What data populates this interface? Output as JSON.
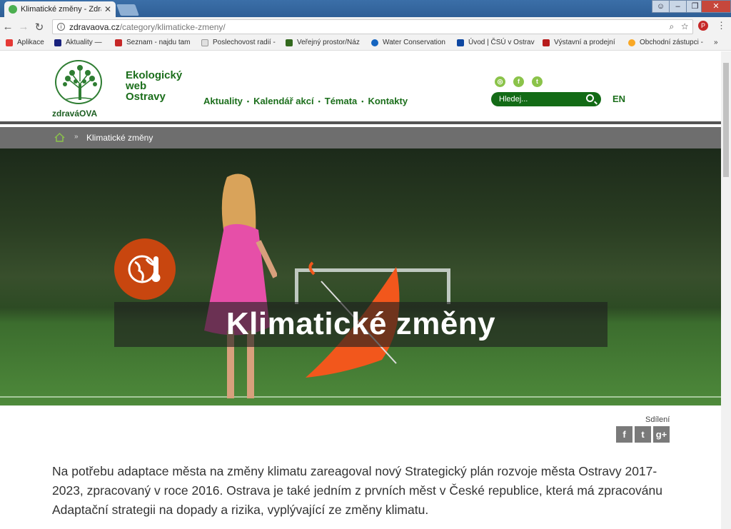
{
  "browser": {
    "tab_title": "Klimatické změny - Zdrav",
    "url_domain": "zdravaova.cz",
    "url_path": "/category/klimaticke-zmeny/",
    "bookmarks": [
      {
        "label": "Aplikace",
        "color": "#e53935"
      },
      {
        "label": "Aktuality —",
        "color": "#1a237e"
      },
      {
        "label": "Seznam - najdu tam",
        "color": "#c62828"
      },
      {
        "label": "Poslechovost radií -",
        "color": "#9e9e9e"
      },
      {
        "label": "Veřejný prostor/Náz",
        "color": "#33691e"
      },
      {
        "label": "Water Conservation",
        "color": "#1565c0"
      },
      {
        "label": "Úvod | ČSÚ v Ostrav",
        "color": "#0d47a1"
      },
      {
        "label": "Výstavní a prodejní",
        "color": "#b71c1c"
      },
      {
        "label": "Obchodní zástupci -",
        "color": "#f9a825"
      }
    ],
    "overflow": "»"
  },
  "header": {
    "logo_text": "zdraváOVA",
    "title_line1": "Ekologický",
    "title_line2": "web",
    "title_line3": "Ostravy",
    "nav": [
      "Aktuality",
      "Kalendář akcí",
      "Témata",
      "Kontakty"
    ],
    "nav_separator": "•",
    "search_placeholder": "Hledej...",
    "lang": "EN"
  },
  "breadcrumb": {
    "separator": "»",
    "current": "Klimatické změny"
  },
  "hero": {
    "title": "Klimatické změny"
  },
  "share": {
    "label": "Sdílení",
    "buttons": [
      "f",
      "t",
      "g+"
    ]
  },
  "content": {
    "intro": "Na potřebu adaptace města na změny klimatu zareagoval nový Strategický plán rozvoje města Ostravy 2017-2023, zpracovaný v roce 2016. Ostrava je také jedním z prvních měst v České republice, která má zpracovánu Adaptační strategii na dopady a rizika, vyplývající ze změny klimatu."
  },
  "colors": {
    "brand_green": "#1b6e1b",
    "accent_orange": "#c8460f",
    "social_green": "#8bc34a"
  }
}
